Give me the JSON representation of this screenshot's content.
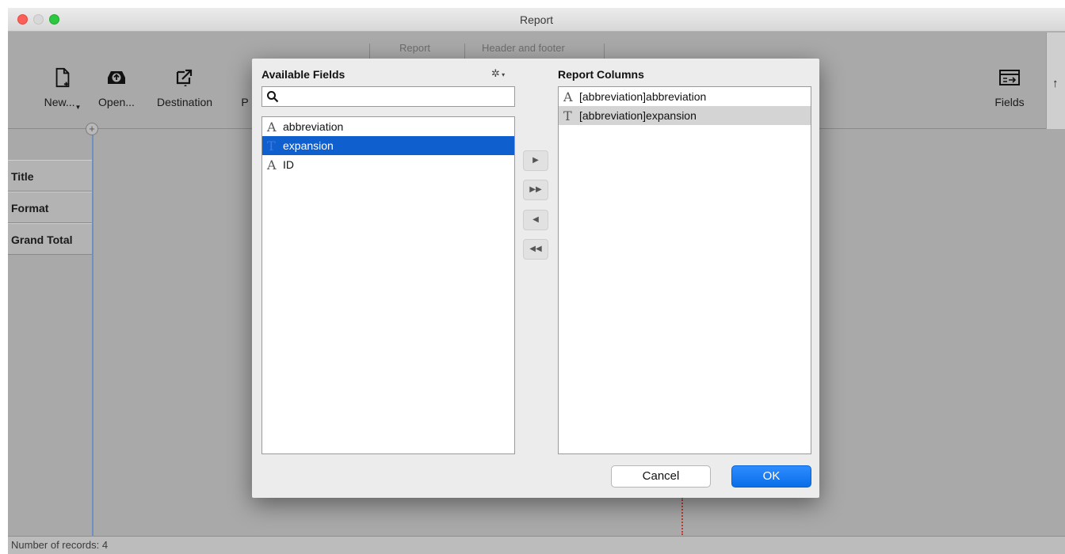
{
  "window": {
    "title": "Report"
  },
  "toolbar": {
    "tabs": [
      "Report",
      "Header and footer"
    ],
    "buttons": [
      {
        "label": "New...",
        "icon": "new-document-icon"
      },
      {
        "label": "Open...",
        "icon": "open-tray-icon"
      },
      {
        "label": "Destination",
        "icon": "export-arrow-icon"
      },
      {
        "label": "P",
        "icon": "print-icon"
      }
    ],
    "fields_button": {
      "label": "Fields",
      "icon": "fields-table-icon"
    },
    "scroll_arrow": "↑"
  },
  "report_parts": [
    "Title",
    "Format",
    "Grand Total"
  ],
  "status_bar": {
    "text": "Number of records: 4"
  },
  "dialog": {
    "available_fields_title": "Available Fields",
    "report_columns_title": "Report Columns",
    "search": {
      "value": "",
      "placeholder": ""
    },
    "available_fields": [
      {
        "name": "abbreviation",
        "type_glyph": "A",
        "selected": false
      },
      {
        "name": "expansion",
        "type_glyph": "T",
        "selected": true
      },
      {
        "name": "ID",
        "type_glyph": "A",
        "selected": false
      }
    ],
    "report_columns": [
      {
        "name": "[abbreviation]abbreviation",
        "type_glyph": "A",
        "selected": false
      },
      {
        "name": "[abbreviation]expansion",
        "type_glyph": "T",
        "selected": true
      }
    ],
    "move_buttons": [
      "▶",
      "▶▶",
      "◀",
      "◀◀"
    ],
    "cancel_label": "Cancel",
    "ok_label": "OK"
  },
  "colors": {
    "selection_blue": "#0f5fcf",
    "ok_blue": "#0a6ee8",
    "close_red": "#fc5f57",
    "zoom_green": "#2bc840"
  }
}
